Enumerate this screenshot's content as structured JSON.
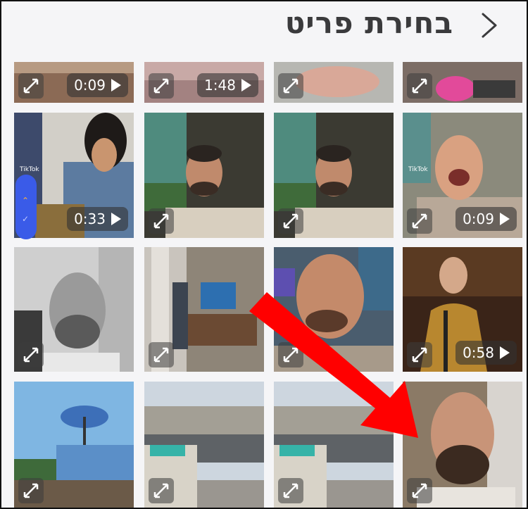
{
  "header": {
    "title": "בחירת פריט",
    "back_icon": "chevron-right-icon"
  },
  "tiles": [
    {
      "id": "r0c0",
      "duration": "0:09",
      "video": true
    },
    {
      "id": "r0c1",
      "duration": "1:48",
      "video": true
    },
    {
      "id": "r0c2",
      "video": false
    },
    {
      "id": "r0c3",
      "video": false
    },
    {
      "id": "r1c0",
      "duration": "0:33",
      "video": true,
      "badge": "TikTok"
    },
    {
      "id": "r1c1",
      "video": false
    },
    {
      "id": "r1c2",
      "video": false
    },
    {
      "id": "r1c3",
      "duration": "0:09",
      "video": true,
      "badge": "TikTok"
    },
    {
      "id": "r2c0",
      "video": false
    },
    {
      "id": "r2c1",
      "video": false
    },
    {
      "id": "r2c2",
      "video": false
    },
    {
      "id": "r2c3",
      "duration": "0:58",
      "video": true
    },
    {
      "id": "r3c0",
      "video": false
    },
    {
      "id": "r3c1",
      "video": false
    },
    {
      "id": "r3c2",
      "video": false
    },
    {
      "id": "r3c3",
      "video": false
    }
  ],
  "colors": {
    "annotation_arrow": "#ff0000",
    "scroll_indicator": "#3a5be8"
  }
}
